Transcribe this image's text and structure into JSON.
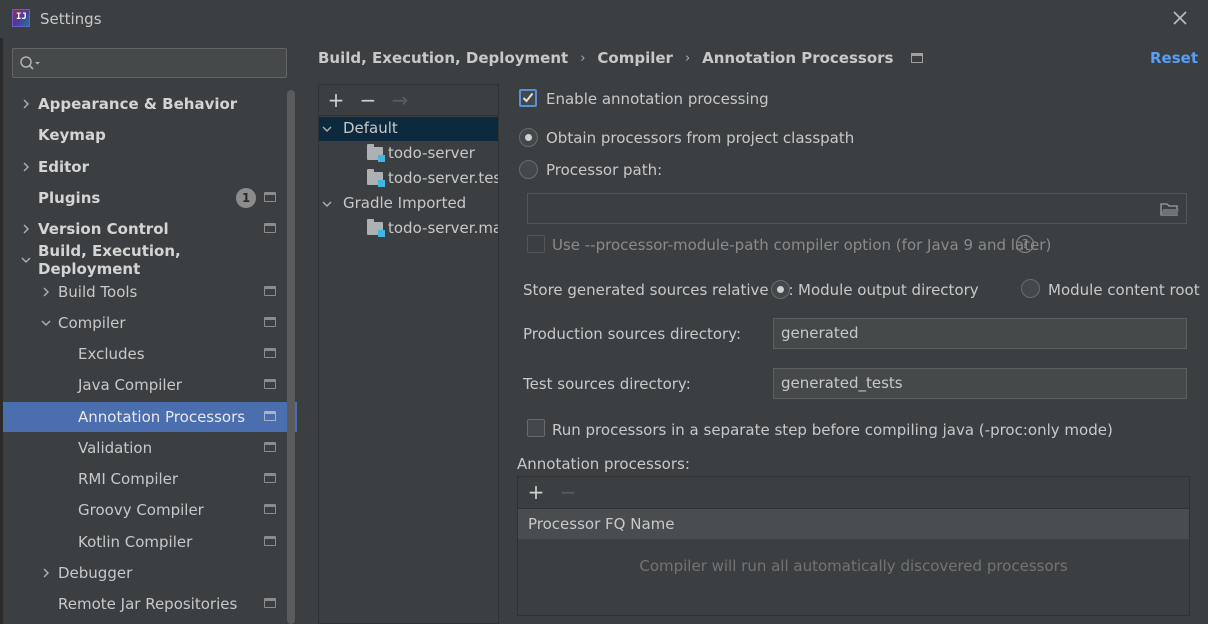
{
  "window": {
    "title": "Settings",
    "app_icon_text": "IJ"
  },
  "search": {
    "placeholder": ""
  },
  "sidebar": {
    "items": [
      {
        "label": "Appearance & Behavior"
      },
      {
        "label": "Keymap"
      },
      {
        "label": "Editor"
      },
      {
        "label": "Plugins",
        "badge": "1"
      },
      {
        "label": "Version Control"
      },
      {
        "label": "Build, Execution, Deployment"
      },
      {
        "label": "Build Tools"
      },
      {
        "label": "Compiler"
      },
      {
        "label": "Excludes"
      },
      {
        "label": "Java Compiler"
      },
      {
        "label": "Annotation Processors"
      },
      {
        "label": "Validation"
      },
      {
        "label": "RMI Compiler"
      },
      {
        "label": "Groovy Compiler"
      },
      {
        "label": "Kotlin Compiler"
      },
      {
        "label": "Debugger"
      },
      {
        "label": "Remote Jar Repositories"
      }
    ]
  },
  "breadcrumb": [
    "Build, Execution, Deployment",
    "Compiler",
    "Annotation Processors"
  ],
  "reset_label": "Reset",
  "profiles": {
    "add": "+",
    "remove": "−",
    "move": "→",
    "items": [
      {
        "label": "Default"
      },
      {
        "label": "todo-server"
      },
      {
        "label": "todo-server.test"
      },
      {
        "label": "Gradle Imported"
      },
      {
        "label": "todo-server.main"
      }
    ]
  },
  "form": {
    "enable_label": "Enable annotation processing",
    "enable_checked": true,
    "obtain_label": "Obtain processors from project classpath",
    "processor_path_label": "Processor path:",
    "processor_path_value": "",
    "module_path_label": "Use --processor-module-path compiler option (for Java 9 and later)",
    "help_glyph": "?",
    "store_label": "Store generated sources relative to:",
    "module_output_label": "Module output directory",
    "module_content_label": "Module content root",
    "prod_dir_label": "Production sources directory:",
    "prod_dir_value": "generated",
    "test_dir_label": "Test sources directory:",
    "test_dir_value": "generated_tests",
    "separate_step_label": "Run processors in a separate step before compiling java (-proc:only mode)",
    "ap_label": "Annotation processors:"
  },
  "ap_table": {
    "add": "+",
    "remove": "−",
    "column": "Processor FQ Name",
    "empty_text": "Compiler will run all automatically discovered processors"
  },
  "colors": {
    "accent": "#4b6eaf",
    "link": "#589df6",
    "background": "#3c3f41"
  }
}
